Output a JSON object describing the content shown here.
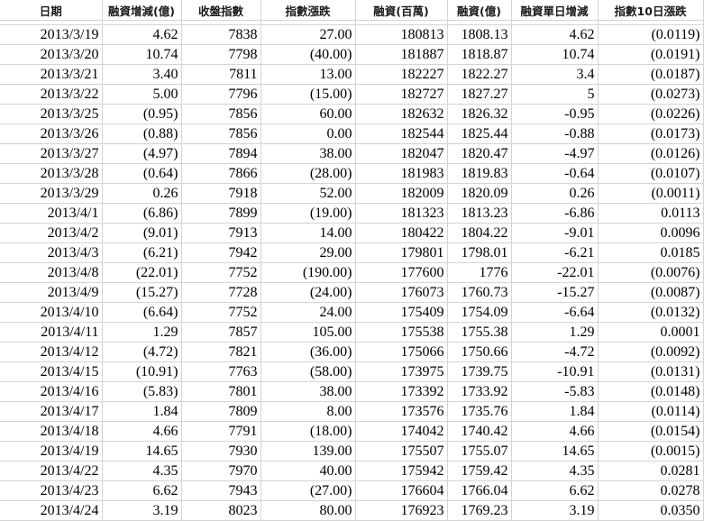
{
  "headers": [
    "日期",
    "融資增減(億)",
    "收盤指數",
    "指數漲跌",
    "融資(百萬)",
    "融資(億)",
    "融資單日增減",
    "指數10日漲跌"
  ],
  "colors": {
    "negative": "#ff0000",
    "gridline": "#d4d4d4"
  },
  "rows": [
    [
      "2013/3/19",
      "4.62",
      "7838",
      "27.00",
      "180813",
      "1808.13",
      "4.62",
      "(0.0119)"
    ],
    [
      "2013/3/20",
      "10.74",
      "7798",
      "(40.00)",
      "181887",
      "1818.87",
      "10.74",
      "(0.0191)"
    ],
    [
      "2013/3/21",
      "3.40",
      "7811",
      "13.00",
      "182227",
      "1822.27",
      "3.4",
      "(0.0187)"
    ],
    [
      "2013/3/22",
      "5.00",
      "7796",
      "(15.00)",
      "182727",
      "1827.27",
      "5",
      "(0.0273)"
    ],
    [
      "2013/3/25",
      "(0.95)",
      "7856",
      "60.00",
      "182632",
      "1826.32",
      "-0.95",
      "(0.0226)"
    ],
    [
      "2013/3/26",
      "(0.88)",
      "7856",
      "0.00",
      "182544",
      "1825.44",
      "-0.88",
      "(0.0173)"
    ],
    [
      "2013/3/27",
      "(4.97)",
      "7894",
      "38.00",
      "182047",
      "1820.47",
      "-4.97",
      "(0.0126)"
    ],
    [
      "2013/3/28",
      "(0.64)",
      "7866",
      "(28.00)",
      "181983",
      "1819.83",
      "-0.64",
      "(0.0107)"
    ],
    [
      "2013/3/29",
      "0.26",
      "7918",
      "52.00",
      "182009",
      "1820.09",
      "0.26",
      "(0.0011)"
    ],
    [
      "2013/4/1",
      "(6.86)",
      "7899",
      "(19.00)",
      "181323",
      "1813.23",
      "-6.86",
      "0.0113"
    ],
    [
      "2013/4/2",
      "(9.01)",
      "7913",
      "14.00",
      "180422",
      "1804.22",
      "-9.01",
      "0.0096"
    ],
    [
      "2013/4/3",
      "(6.21)",
      "7942",
      "29.00",
      "179801",
      "1798.01",
      "-6.21",
      "0.0185"
    ],
    [
      "2013/4/8",
      "(22.01)",
      "7752",
      "(190.00)",
      "177600",
      "1776",
      "-22.01",
      "(0.0076)"
    ],
    [
      "2013/4/9",
      "(15.27)",
      "7728",
      "(24.00)",
      "176073",
      "1760.73",
      "-15.27",
      "(0.0087)"
    ],
    [
      "2013/4/10",
      "(6.64)",
      "7752",
      "24.00",
      "175409",
      "1754.09",
      "-6.64",
      "(0.0132)"
    ],
    [
      "2013/4/11",
      "1.29",
      "7857",
      "105.00",
      "175538",
      "1755.38",
      "1.29",
      "0.0001"
    ],
    [
      "2013/4/12",
      "(4.72)",
      "7821",
      "(36.00)",
      "175066",
      "1750.66",
      "-4.72",
      "(0.0092)"
    ],
    [
      "2013/4/15",
      "(10.91)",
      "7763",
      "(58.00)",
      "173975",
      "1739.75",
      "-10.91",
      "(0.0131)"
    ],
    [
      "2013/4/16",
      "(5.83)",
      "7801",
      "38.00",
      "173392",
      "1733.92",
      "-5.83",
      "(0.0148)"
    ],
    [
      "2013/4/17",
      "1.84",
      "7809",
      "8.00",
      "173576",
      "1735.76",
      "1.84",
      "(0.0114)"
    ],
    [
      "2013/4/18",
      "4.66",
      "7791",
      "(18.00)",
      "174042",
      "1740.42",
      "4.66",
      "(0.0154)"
    ],
    [
      "2013/4/19",
      "14.65",
      "7930",
      "139.00",
      "175507",
      "1755.07",
      "14.65",
      "(0.0015)"
    ],
    [
      "2013/4/22",
      "4.35",
      "7970",
      "40.00",
      "175942",
      "1759.42",
      "4.35",
      "0.0281"
    ],
    [
      "2013/4/23",
      "6.62",
      "7943",
      "(27.00)",
      "176604",
      "1766.04",
      "6.62",
      "0.0278"
    ],
    [
      "2013/4/24",
      "3.19",
      "8023",
      "80.00",
      "176923",
      "1769.23",
      "3.19",
      "0.0350"
    ]
  ]
}
